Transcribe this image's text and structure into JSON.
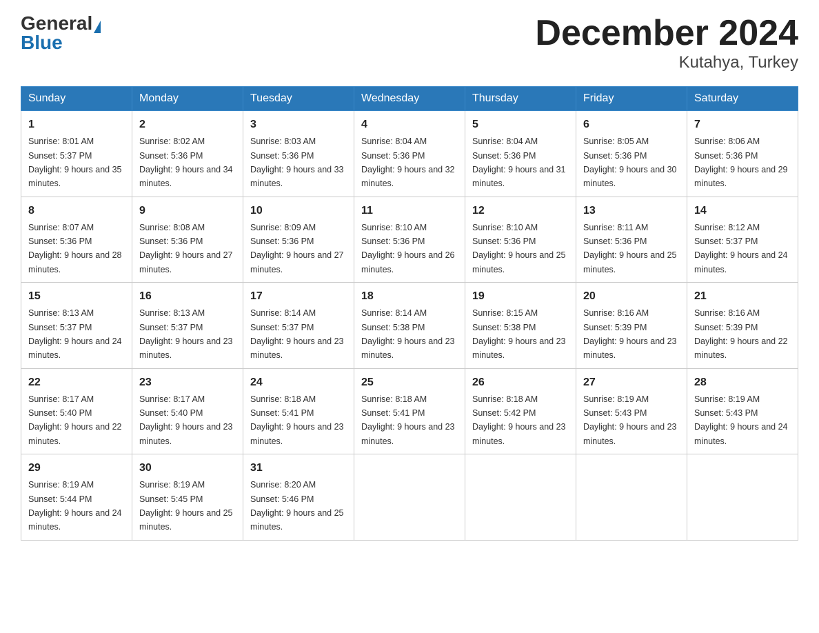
{
  "header": {
    "logo_general": "General",
    "logo_blue": "Blue",
    "month_title": "December 2024",
    "location": "Kutahya, Turkey"
  },
  "days_of_week": [
    "Sunday",
    "Monday",
    "Tuesday",
    "Wednesday",
    "Thursday",
    "Friday",
    "Saturday"
  ],
  "weeks": [
    [
      {
        "day": "1",
        "sunrise": "8:01 AM",
        "sunset": "5:37 PM",
        "daylight": "9 hours and 35 minutes."
      },
      {
        "day": "2",
        "sunrise": "8:02 AM",
        "sunset": "5:36 PM",
        "daylight": "9 hours and 34 minutes."
      },
      {
        "day": "3",
        "sunrise": "8:03 AM",
        "sunset": "5:36 PM",
        "daylight": "9 hours and 33 minutes."
      },
      {
        "day": "4",
        "sunrise": "8:04 AM",
        "sunset": "5:36 PM",
        "daylight": "9 hours and 32 minutes."
      },
      {
        "day": "5",
        "sunrise": "8:04 AM",
        "sunset": "5:36 PM",
        "daylight": "9 hours and 31 minutes."
      },
      {
        "day": "6",
        "sunrise": "8:05 AM",
        "sunset": "5:36 PM",
        "daylight": "9 hours and 30 minutes."
      },
      {
        "day": "7",
        "sunrise": "8:06 AM",
        "sunset": "5:36 PM",
        "daylight": "9 hours and 29 minutes."
      }
    ],
    [
      {
        "day": "8",
        "sunrise": "8:07 AM",
        "sunset": "5:36 PM",
        "daylight": "9 hours and 28 minutes."
      },
      {
        "day": "9",
        "sunrise": "8:08 AM",
        "sunset": "5:36 PM",
        "daylight": "9 hours and 27 minutes."
      },
      {
        "day": "10",
        "sunrise": "8:09 AM",
        "sunset": "5:36 PM",
        "daylight": "9 hours and 27 minutes."
      },
      {
        "day": "11",
        "sunrise": "8:10 AM",
        "sunset": "5:36 PM",
        "daylight": "9 hours and 26 minutes."
      },
      {
        "day": "12",
        "sunrise": "8:10 AM",
        "sunset": "5:36 PM",
        "daylight": "9 hours and 25 minutes."
      },
      {
        "day": "13",
        "sunrise": "8:11 AM",
        "sunset": "5:36 PM",
        "daylight": "9 hours and 25 minutes."
      },
      {
        "day": "14",
        "sunrise": "8:12 AM",
        "sunset": "5:37 PM",
        "daylight": "9 hours and 24 minutes."
      }
    ],
    [
      {
        "day": "15",
        "sunrise": "8:13 AM",
        "sunset": "5:37 PM",
        "daylight": "9 hours and 24 minutes."
      },
      {
        "day": "16",
        "sunrise": "8:13 AM",
        "sunset": "5:37 PM",
        "daylight": "9 hours and 23 minutes."
      },
      {
        "day": "17",
        "sunrise": "8:14 AM",
        "sunset": "5:37 PM",
        "daylight": "9 hours and 23 minutes."
      },
      {
        "day": "18",
        "sunrise": "8:14 AM",
        "sunset": "5:38 PM",
        "daylight": "9 hours and 23 minutes."
      },
      {
        "day": "19",
        "sunrise": "8:15 AM",
        "sunset": "5:38 PM",
        "daylight": "9 hours and 23 minutes."
      },
      {
        "day": "20",
        "sunrise": "8:16 AM",
        "sunset": "5:39 PM",
        "daylight": "9 hours and 23 minutes."
      },
      {
        "day": "21",
        "sunrise": "8:16 AM",
        "sunset": "5:39 PM",
        "daylight": "9 hours and 22 minutes."
      }
    ],
    [
      {
        "day": "22",
        "sunrise": "8:17 AM",
        "sunset": "5:40 PM",
        "daylight": "9 hours and 22 minutes."
      },
      {
        "day": "23",
        "sunrise": "8:17 AM",
        "sunset": "5:40 PM",
        "daylight": "9 hours and 23 minutes."
      },
      {
        "day": "24",
        "sunrise": "8:18 AM",
        "sunset": "5:41 PM",
        "daylight": "9 hours and 23 minutes."
      },
      {
        "day": "25",
        "sunrise": "8:18 AM",
        "sunset": "5:41 PM",
        "daylight": "9 hours and 23 minutes."
      },
      {
        "day": "26",
        "sunrise": "8:18 AM",
        "sunset": "5:42 PM",
        "daylight": "9 hours and 23 minutes."
      },
      {
        "day": "27",
        "sunrise": "8:19 AM",
        "sunset": "5:43 PM",
        "daylight": "9 hours and 23 minutes."
      },
      {
        "day": "28",
        "sunrise": "8:19 AM",
        "sunset": "5:43 PM",
        "daylight": "9 hours and 24 minutes."
      }
    ],
    [
      {
        "day": "29",
        "sunrise": "8:19 AM",
        "sunset": "5:44 PM",
        "daylight": "9 hours and 24 minutes."
      },
      {
        "day": "30",
        "sunrise": "8:19 AM",
        "sunset": "5:45 PM",
        "daylight": "9 hours and 25 minutes."
      },
      {
        "day": "31",
        "sunrise": "8:20 AM",
        "sunset": "5:46 PM",
        "daylight": "9 hours and 25 minutes."
      },
      null,
      null,
      null,
      null
    ]
  ],
  "labels": {
    "sunrise_prefix": "Sunrise: ",
    "sunset_prefix": "Sunset: ",
    "daylight_prefix": "Daylight: "
  }
}
